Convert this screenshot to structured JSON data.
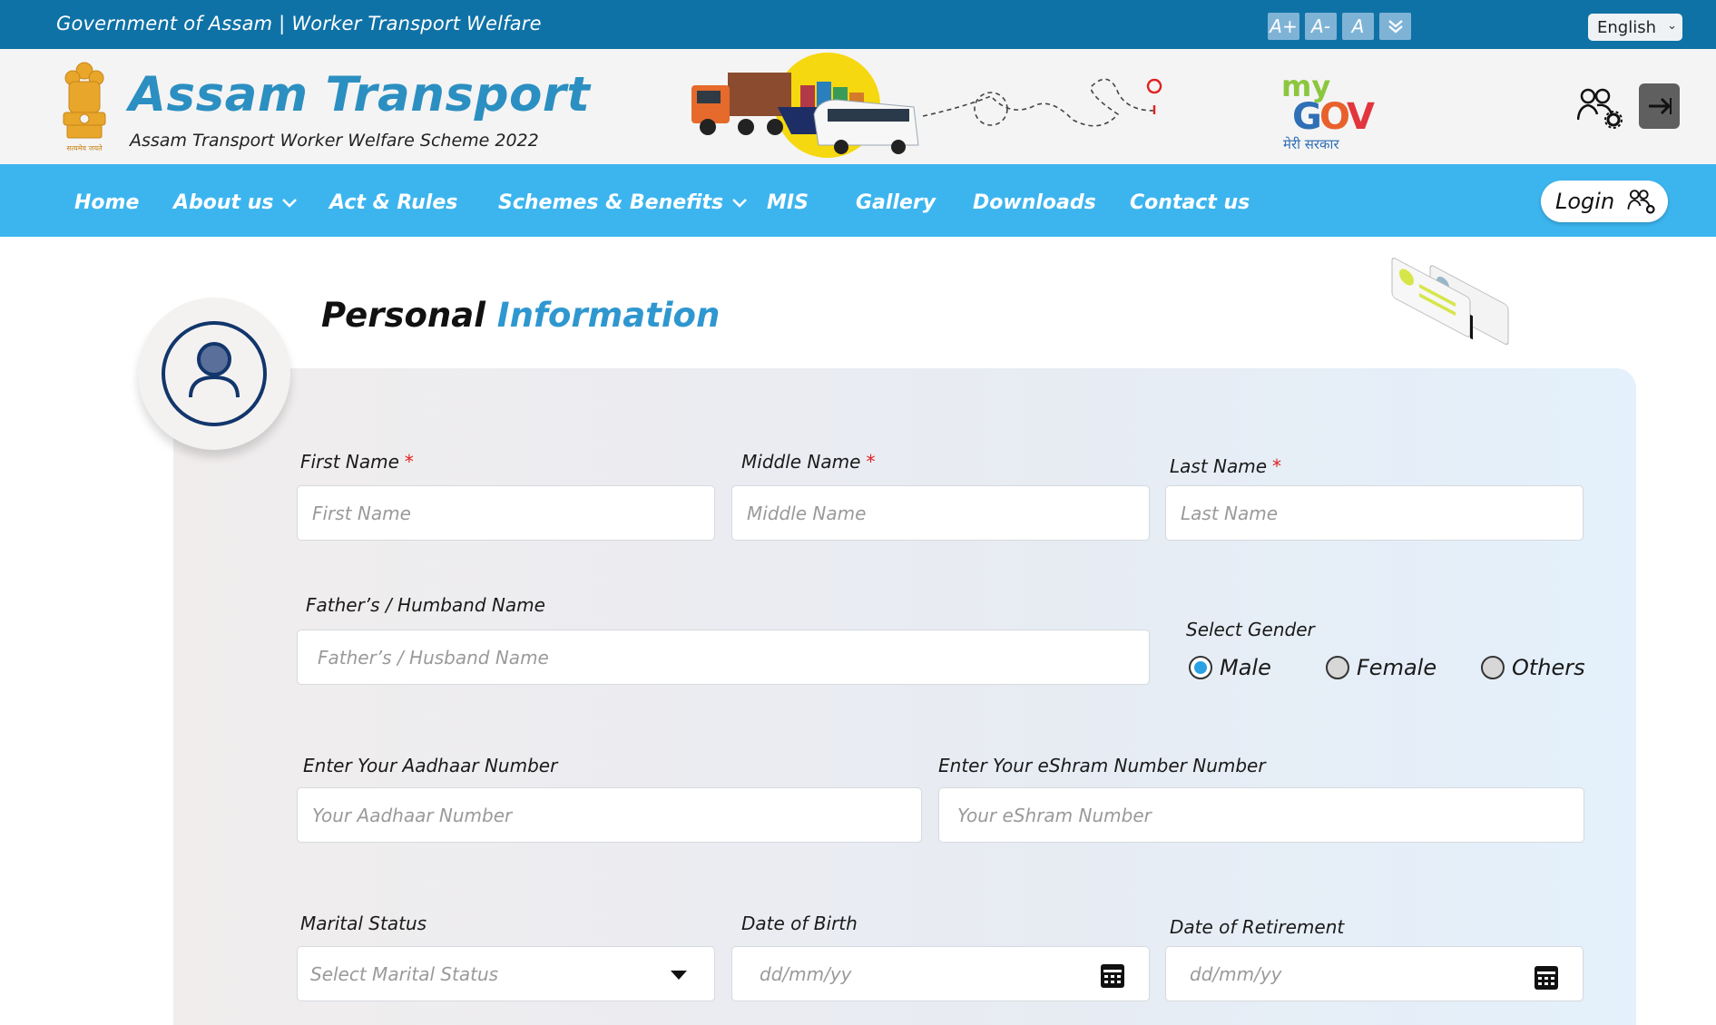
{
  "topbar": {
    "government_text": "Government of Assam | Worker Transport  Welfare",
    "font_controls": [
      "A+",
      "A-",
      "A"
    ],
    "language": "English"
  },
  "header": {
    "brand": "Assam Transport",
    "tagline": "Assam Transport Worker Welfare Scheme 2022",
    "emblem_motto": "सत्यमेव जयते",
    "mygov_sub": "मेरी सरकार"
  },
  "nav": {
    "items": [
      "Home",
      "About us",
      "Act & Rules",
      "Schemes & Benefits",
      "MIS",
      "Gallery",
      "Downloads",
      "Contact us"
    ],
    "login_label": "Login"
  },
  "page": {
    "title_part1": "Personal",
    "title_part2": "Information"
  },
  "form": {
    "first_name": {
      "label": "First Name",
      "placeholder": "First Name",
      "required": "*"
    },
    "middle_name": {
      "label": "Middle Name",
      "placeholder": "Middle Name",
      "required": "*"
    },
    "last_name": {
      "label": "Last Name",
      "placeholder": "Last Name",
      "required": "*"
    },
    "father_name": {
      "label": "Father’s / Humband Name",
      "placeholder": "Father’s / Husband Name"
    },
    "gender": {
      "label": "Select Gender",
      "options": [
        "Male",
        "Female",
        "Others"
      ],
      "selected": "Male"
    },
    "aadhaar": {
      "label": "Enter Your Aadhaar Number",
      "placeholder": "Your Aadhaar Number"
    },
    "eshram": {
      "label": "Enter Your eShram Number Number",
      "placeholder": "Your eShram Number"
    },
    "marital": {
      "label": "Marital Status",
      "placeholder": "Select Marital Status"
    },
    "dob": {
      "label": "Date of Birth",
      "placeholder": "dd/mm/yy"
    },
    "retirement": {
      "label": "Date of Retirement",
      "placeholder": "dd/mm/yy"
    }
  },
  "colors": {
    "topbar": "#0f72a6",
    "nav": "#3cb5ef",
    "brand": "#2c8fc1",
    "title_accent": "#2f97cf",
    "required": "#e02020",
    "radio_selected": "#2aa1e3"
  }
}
